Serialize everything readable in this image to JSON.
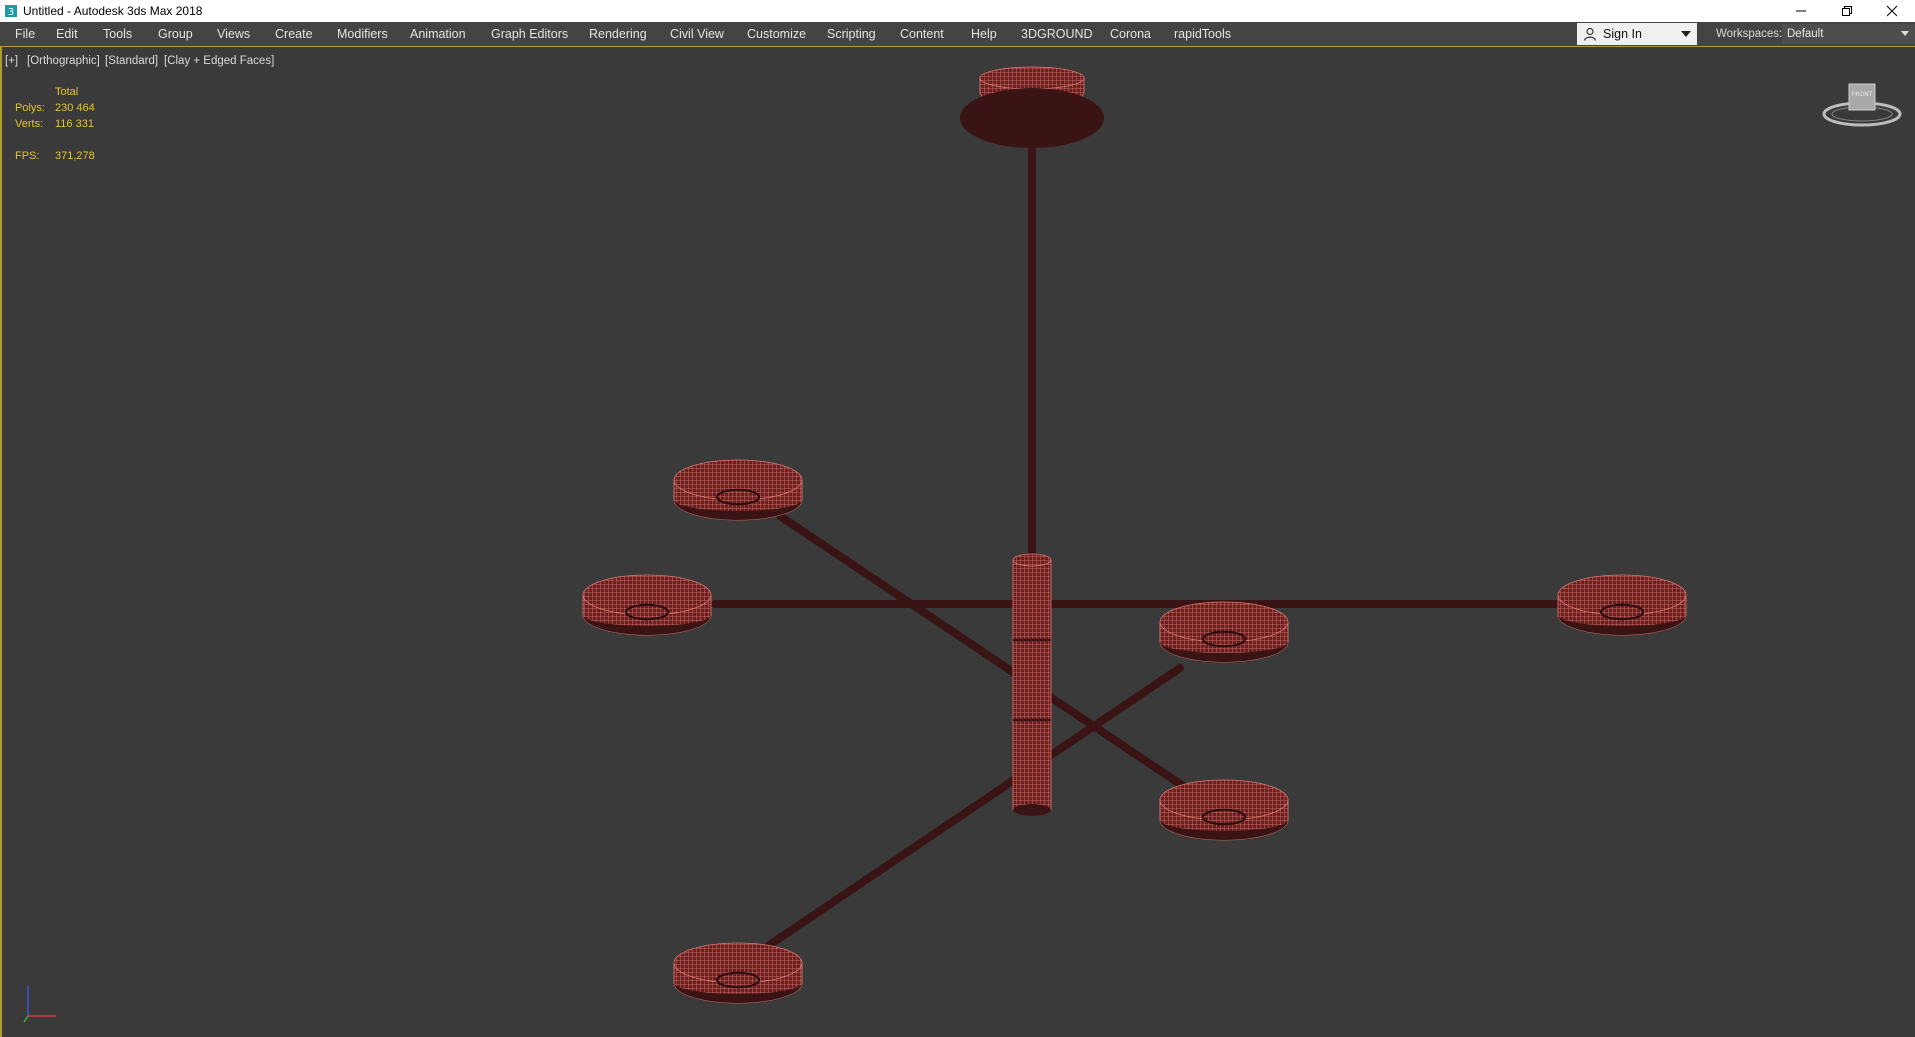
{
  "window": {
    "title": "Untitled - Autodesk 3ds Max 2018",
    "app_icon": "3ds-max-app-icon",
    "controls": [
      "minimize-icon",
      "restore-icon",
      "close-icon"
    ]
  },
  "menu": {
    "items": [
      "File",
      "Edit",
      "Tools",
      "Group",
      "Views",
      "Create",
      "Modifiers",
      "Animation",
      "Graph Editors",
      "Rendering",
      "Civil View",
      "Customize",
      "Scripting",
      "Content",
      "Help",
      "3DGROUND",
      "Corona",
      "rapidTools"
    ]
  },
  "account": {
    "sign_in_label": "Sign In",
    "icon": "user-icon"
  },
  "workspaces": {
    "label": "Workspaces:",
    "value": "Default"
  },
  "viewport": {
    "label_plus": "[+]",
    "label_view": "[Orthographic]",
    "label_shading": "[Standard]",
    "label_mode": "[Clay + Edged Faces]",
    "stats": {
      "header": "Total",
      "polys_label": "Polys:",
      "polys_value": "230 464",
      "verts_label": "Verts:",
      "verts_value": "116 331",
      "fps_label": "FPS:",
      "fps_value": "371,278"
    },
    "viewcube_face": "FRONT",
    "colors": {
      "stats_text": "#e3c531",
      "background": "#3a3a3a",
      "mesh_rod": "#3a1414",
      "mesh_wire": "#e07a74",
      "active_border": "#b39a2e"
    }
  }
}
